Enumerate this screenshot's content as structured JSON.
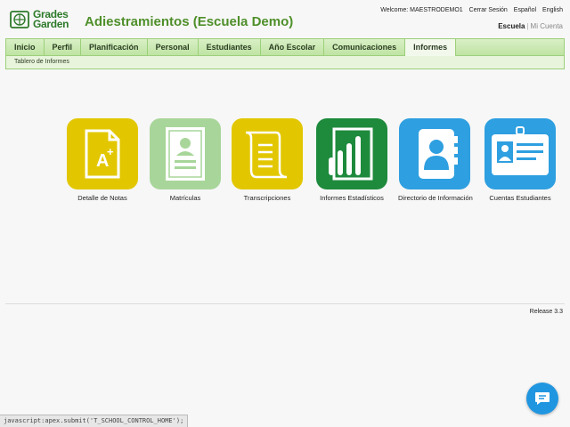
{
  "header": {
    "logo_line1": "Grades",
    "logo_line2": "Garden",
    "app_title": "Adiestramientos (Escuela Demo)",
    "welcome": "Welcome: MAESTRODEMO1",
    "logout": "Cerrar Sesión",
    "lang_es": "Español",
    "lang_en": "English",
    "escuela": "Escuela",
    "mi_cuenta": "Mi Cuenta"
  },
  "nav": {
    "tabs": [
      {
        "label": "Inicio"
      },
      {
        "label": "Perfil"
      },
      {
        "label": "Planificación"
      },
      {
        "label": "Personal"
      },
      {
        "label": "Estudiantes"
      },
      {
        "label": "Año Escolar"
      },
      {
        "label": "Comunicaciones"
      },
      {
        "label": "Informes"
      }
    ],
    "active": "Informes",
    "sub_item": "Tablero de Informes"
  },
  "tiles": [
    {
      "label": "Detalle de Notas",
      "color": "#e2c700",
      "icon": "grade-document-icon"
    },
    {
      "label": "Matrículas",
      "color": "#a8d69a",
      "icon": "enrollment-form-icon"
    },
    {
      "label": "Transcripciones",
      "color": "#e2c700",
      "icon": "scroll-icon"
    },
    {
      "label": "Informes Estadísticos",
      "color": "#1e8a3c",
      "icon": "statistics-chart-icon"
    },
    {
      "label": "Directorio de Información",
      "color": "#2e9fe0",
      "icon": "address-book-icon"
    },
    {
      "label": "Cuentas Estudiantes",
      "color": "#2e9fe0",
      "icon": "id-badge-icon"
    }
  ],
  "footer": {
    "release": "Release 3.3"
  },
  "status_bar": "javascript:apex.submit('T_SCHOOL_CONTROL_HOME');",
  "colors": {
    "accent_green": "#4f8f2a",
    "nav_bg": "#bfe3a3",
    "chat_blue": "#2196e0"
  }
}
